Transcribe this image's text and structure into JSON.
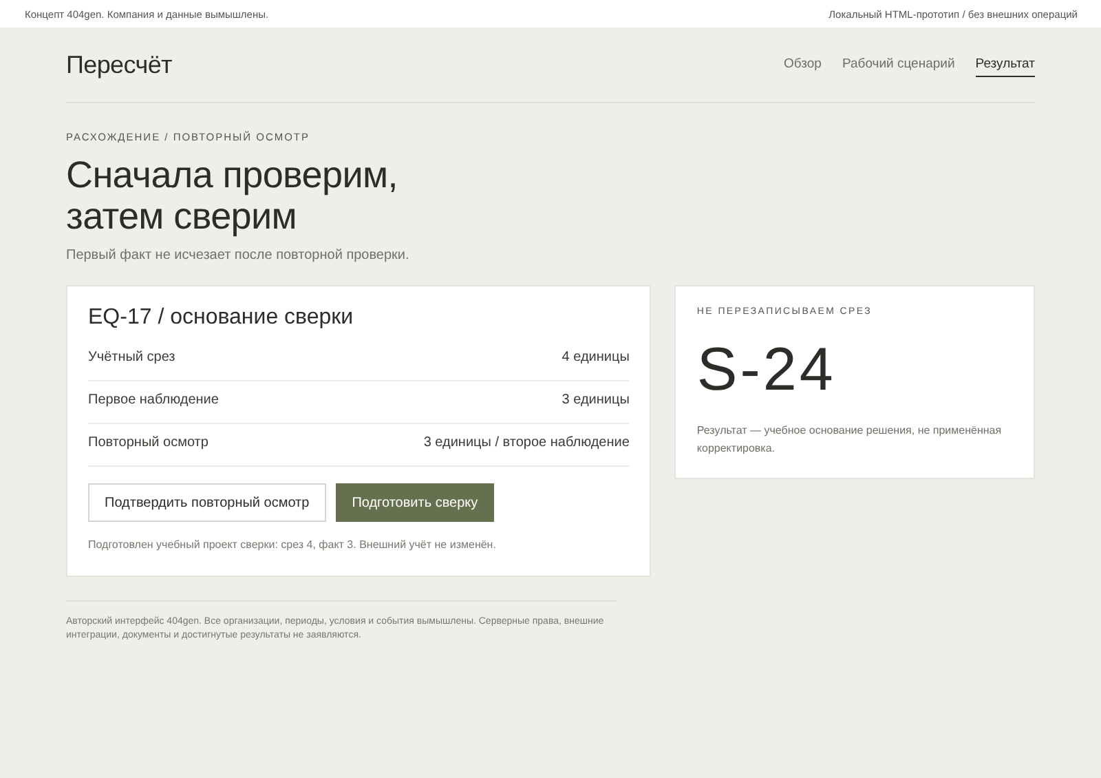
{
  "top_bar": {
    "left": "Концепт 404gen. Компания и данные вымышлены.",
    "right": "Локальный HTML-прототип / без внешних операций"
  },
  "header": {
    "logo": "Пересчёт",
    "nav": [
      {
        "label": "Обзор",
        "selected": false
      },
      {
        "label": "Рабочий сценарий",
        "selected": false
      },
      {
        "label": "Результат",
        "selected": true
      }
    ]
  },
  "eyebrow": "РАСХОЖДЕНИЕ / ПОВТОРНЫЙ ОСМОТР",
  "title_lines": [
    "Сначала проверим,",
    "затем сверим"
  ],
  "subtitle": "Первый факт не исчезает после повторной проверки.",
  "card": {
    "title": "EQ-17 / основание сверки",
    "rows": [
      {
        "label": "Учётный срез",
        "value": "4 единицы"
      },
      {
        "label": "Первое наблюдение",
        "value": "3 единицы"
      },
      {
        "label": "Повторный осмотр",
        "value": "3 единицы / второе наблюдение"
      }
    ],
    "buttons": [
      {
        "label": "Подтвердить повторный осмотр",
        "kind": "secondary"
      },
      {
        "label": "Подготовить сверку",
        "kind": "primary"
      }
    ],
    "note": "Подготовлен учебный проект сверки: срез 4, факт 3. Внешний учёт не изменён."
  },
  "result": {
    "eyebrow": "НЕ ПЕРЕЗАПИСЫВАЕМ СРЕЗ",
    "code": "S-24",
    "text": "Результат — учебное основание решения, не применённая корректировка."
  },
  "footer": "Авторский интерфейс 404gen. Все организации, периоды, условия и события вымышлены. Серверные права, внешние интеграции, документы и достигнутые результаты не заявляются."
}
